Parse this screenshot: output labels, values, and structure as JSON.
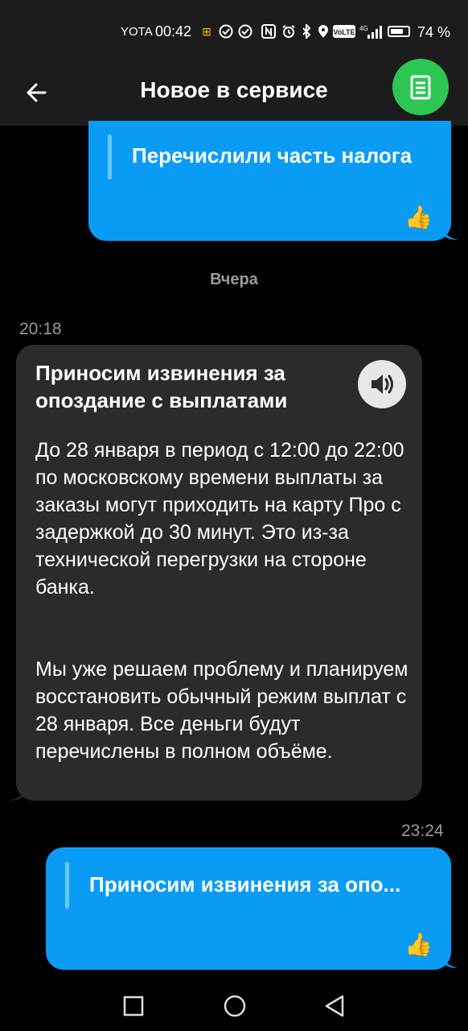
{
  "status_bar": {
    "carrier": "YOTA",
    "time": "00:42",
    "battery_percent_label": "74 %",
    "battery_level": 0.74,
    "icons": [
      "notification-icon",
      "check-circle-icon",
      "check-circle-icon",
      "nfc-icon",
      "alarm-icon",
      "bluetooth-icon",
      "location-icon",
      "volte-icon",
      "signal-icon",
      "battery-icon"
    ]
  },
  "header": {
    "title": "Новое в сервисе",
    "back_icon": "arrow-left-icon",
    "action_icon": "document-icon",
    "action_color": "#2dc653"
  },
  "messages": {
    "top_outgoing": {
      "text": "Перечислили часть налога",
      "reaction": "👍"
    },
    "date_separator": "Вчера",
    "incoming": {
      "time": "20:18",
      "title": "Приносим извинения за опоздание с выплатами",
      "paragraph1": "До 28 января в период с 12:00 до 22:00 по московскому времени выплаты за заказы могут приходить на карту Про с задержкой до 30 минут. Это из-за технической перегрузки на стороне банка.",
      "paragraph2": "Мы уже решаем проблему и планируем восстановить обычный режим выплат с 28 января. Все деньги будут перечислены в полном объёме.",
      "audio_icon": "speaker-icon"
    },
    "bottom_outgoing": {
      "time": "23:24",
      "text": "Приносим извинения за опо...",
      "reaction": "👍"
    }
  },
  "colors": {
    "outgoing_bubble": "#0a9cf5",
    "incoming_bubble": "#2b2b2b",
    "header_bg": "#1c1c1c"
  },
  "nav": {
    "icons": [
      "recent-apps-icon",
      "home-icon",
      "back-icon"
    ]
  }
}
